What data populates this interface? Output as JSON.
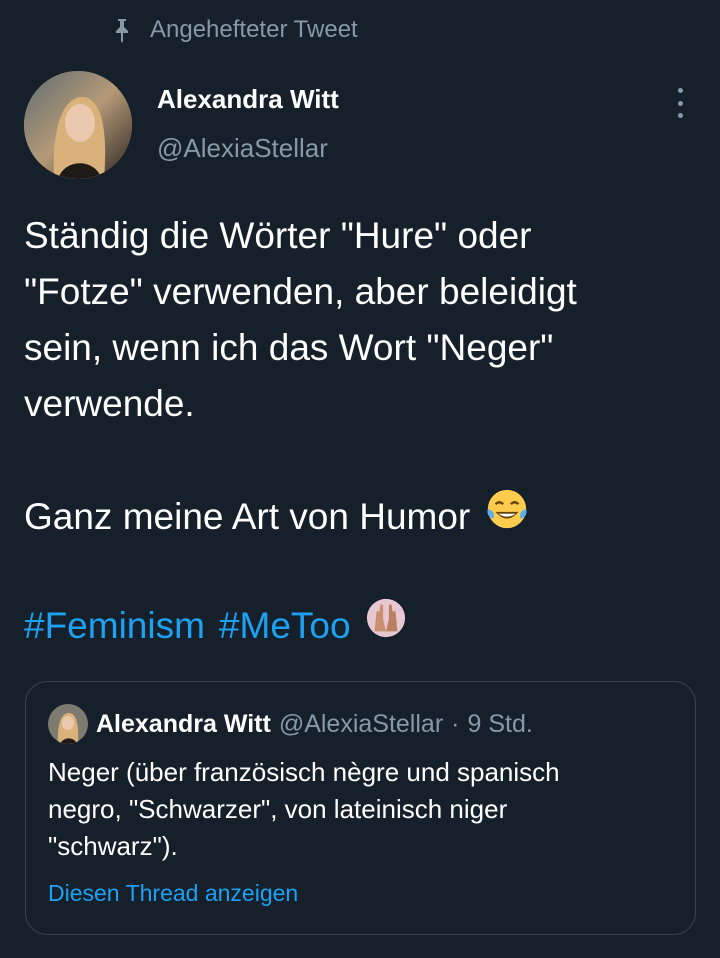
{
  "pinned": {
    "label": "Angehefteter Tweet",
    "icon": "pin-icon"
  },
  "author": {
    "display_name": "Alexandra Witt",
    "handle": "@AlexiaStellar"
  },
  "more_icon": "more-vertical-icon",
  "tweet": {
    "lines": [
      "Ständig die Wörter \"Hure\" oder",
      "\"Fotze\" verwenden, aber beleidigt",
      "sein, wenn ich das Wort \"Neger\"",
      "verwende."
    ],
    "humor_line": "Ganz meine Art von Humor",
    "humor_emoji": "😂",
    "hashtags": [
      "#Feminism",
      "#MeToo"
    ],
    "hashtag_emoji": "🙌"
  },
  "quote": {
    "display_name": "Alexandra Witt",
    "handle": "@AlexiaStellar",
    "separator": "·",
    "time": "9 Std.",
    "lines": [
      "Neger (über französisch nègre und spanisch",
      "negro, \"Schwarzer\", von lateinisch niger",
      "\"schwarz\")."
    ],
    "thread_link": "Diesen Thread anzeigen"
  },
  "colors": {
    "background": "#15202b",
    "text_primary": "#ffffff",
    "text_secondary": "#8899a6",
    "accent": "#1da1f2",
    "border": "#38444d"
  }
}
